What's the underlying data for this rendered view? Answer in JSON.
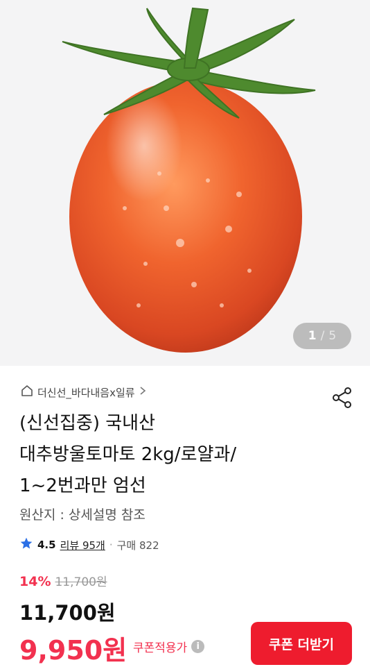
{
  "gallery": {
    "current": "1",
    "separator": "/",
    "total": "5"
  },
  "store": {
    "name": "더신선_바다내음x일류"
  },
  "product": {
    "title_line1": "(신선집중) 국내산",
    "title_line2": "대추방울토마토 2kg/로얄과/",
    "title_line3": "1~2번과만 엄선",
    "origin": "원산지 : 상세설명 참조"
  },
  "rating": {
    "score": "4.5",
    "reviews": "리뷰 95개",
    "purchases": "구매 822"
  },
  "pricing": {
    "discount_rate": "14%",
    "original_price": "11,700원",
    "price": "11,700원",
    "coupon_price": "9,950원",
    "coupon_note": "쿠폰적용가",
    "coupon_button": "쿠폰 더받기"
  },
  "icons": {
    "home": "home-icon",
    "chevron": "chevron-right-icon",
    "share": "share-icon",
    "star": "star-icon",
    "info": "info-icon"
  },
  "colors": {
    "accent_red": "#f2314f",
    "button_red": "#ee1c2e",
    "star_blue": "#2b6fe6"
  }
}
